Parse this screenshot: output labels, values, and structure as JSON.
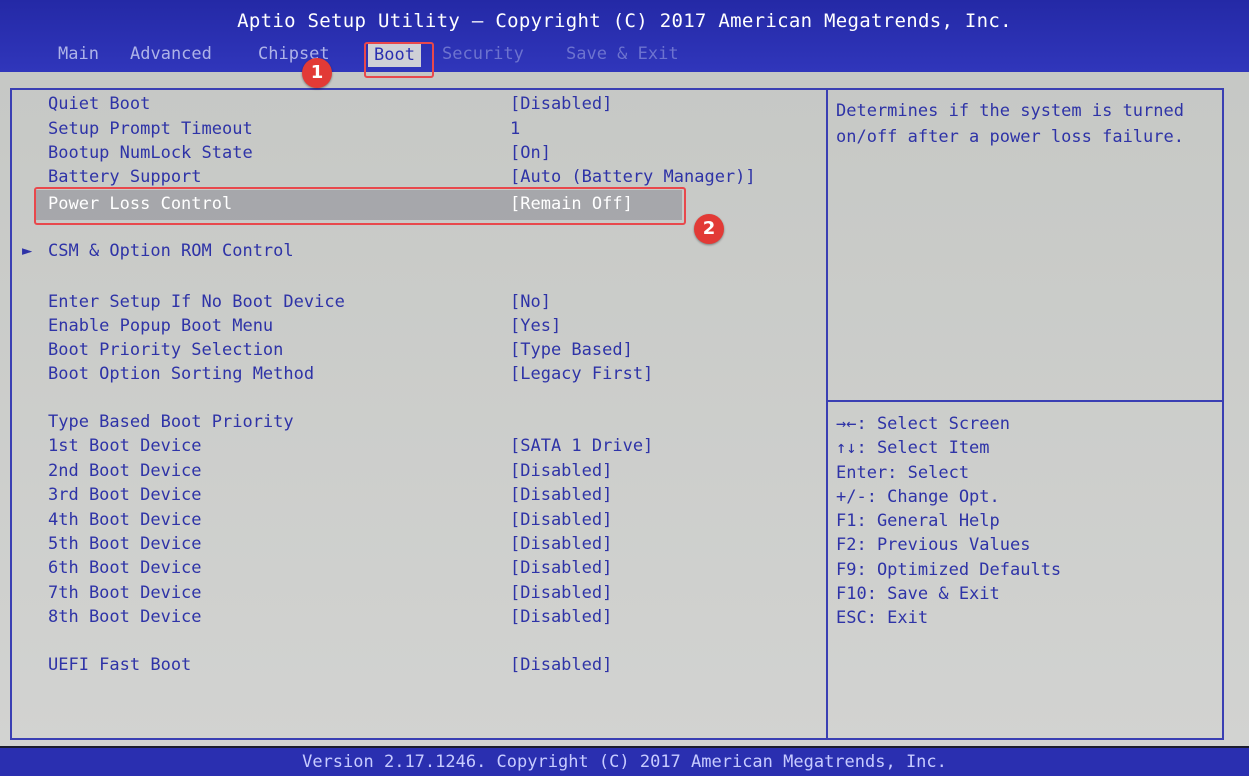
{
  "title": "Aptio Setup Utility – Copyright (C) 2017 American Megatrends, Inc.",
  "menu": {
    "main": "Main",
    "advanced": "Advanced",
    "chipset": "Chipset",
    "boot": "Boot",
    "security": "Security",
    "save_exit": "Save & Exit"
  },
  "annotations": {
    "badge1": "1",
    "badge2": "2"
  },
  "settings": [
    {
      "label": "Quiet Boot",
      "value": "[Disabled]"
    },
    {
      "label": "Setup Prompt Timeout",
      "value": "1"
    },
    {
      "label": "Bootup NumLock State",
      "value": "[On]"
    },
    {
      "label": "Battery Support",
      "value": "[Auto (Battery Manager)]"
    },
    {
      "label": "Power Loss Control",
      "value": "[Remain Off]"
    }
  ],
  "submenu": {
    "arrow": "►",
    "label": "CSM & Option ROM Control"
  },
  "boot_options": [
    {
      "label": "Enter Setup If No Boot Device",
      "value": "[No]"
    },
    {
      "label": "Enable Popup Boot Menu",
      "value": "[Yes]"
    },
    {
      "label": "Boot Priority Selection",
      "value": "[Type Based]"
    },
    {
      "label": "Boot Option Sorting Method",
      "value": "[Legacy First]"
    }
  ],
  "priority_heading": "Type Based Boot Priority",
  "boot_devices": [
    {
      "label": "1st Boot Device",
      "value": "[SATA 1 Drive]"
    },
    {
      "label": "2nd Boot Device",
      "value": "[Disabled]"
    },
    {
      "label": "3rd Boot Device",
      "value": "[Disabled]"
    },
    {
      "label": "4th Boot Device",
      "value": "[Disabled]"
    },
    {
      "label": "5th Boot Device",
      "value": "[Disabled]"
    },
    {
      "label": "6th Boot Device",
      "value": "[Disabled]"
    },
    {
      "label": "7th Boot Device",
      "value": "[Disabled]"
    },
    {
      "label": "8th Boot Device",
      "value": "[Disabled]"
    }
  ],
  "uefi_fast_boot": {
    "label": "UEFI Fast Boot",
    "value": "[Disabled]"
  },
  "help_text": "Determines if the system is turned on/off after a power loss failure.",
  "keys": [
    "→←: Select Screen",
    "↑↓: Select Item",
    "Enter: Select",
    "+/-: Change Opt.",
    "F1: General Help",
    "F2: Previous Values",
    "F9: Optimized Defaults",
    "F10: Save & Exit",
    "ESC: Exit"
  ],
  "footer": "Version 2.17.1246. Copyright (C) 2017 American Megatrends, Inc.",
  "colors": {
    "bios_blue": "#2a2fb0",
    "panel_gray": "#c9cac8",
    "annotation_red": "#e23a36"
  }
}
